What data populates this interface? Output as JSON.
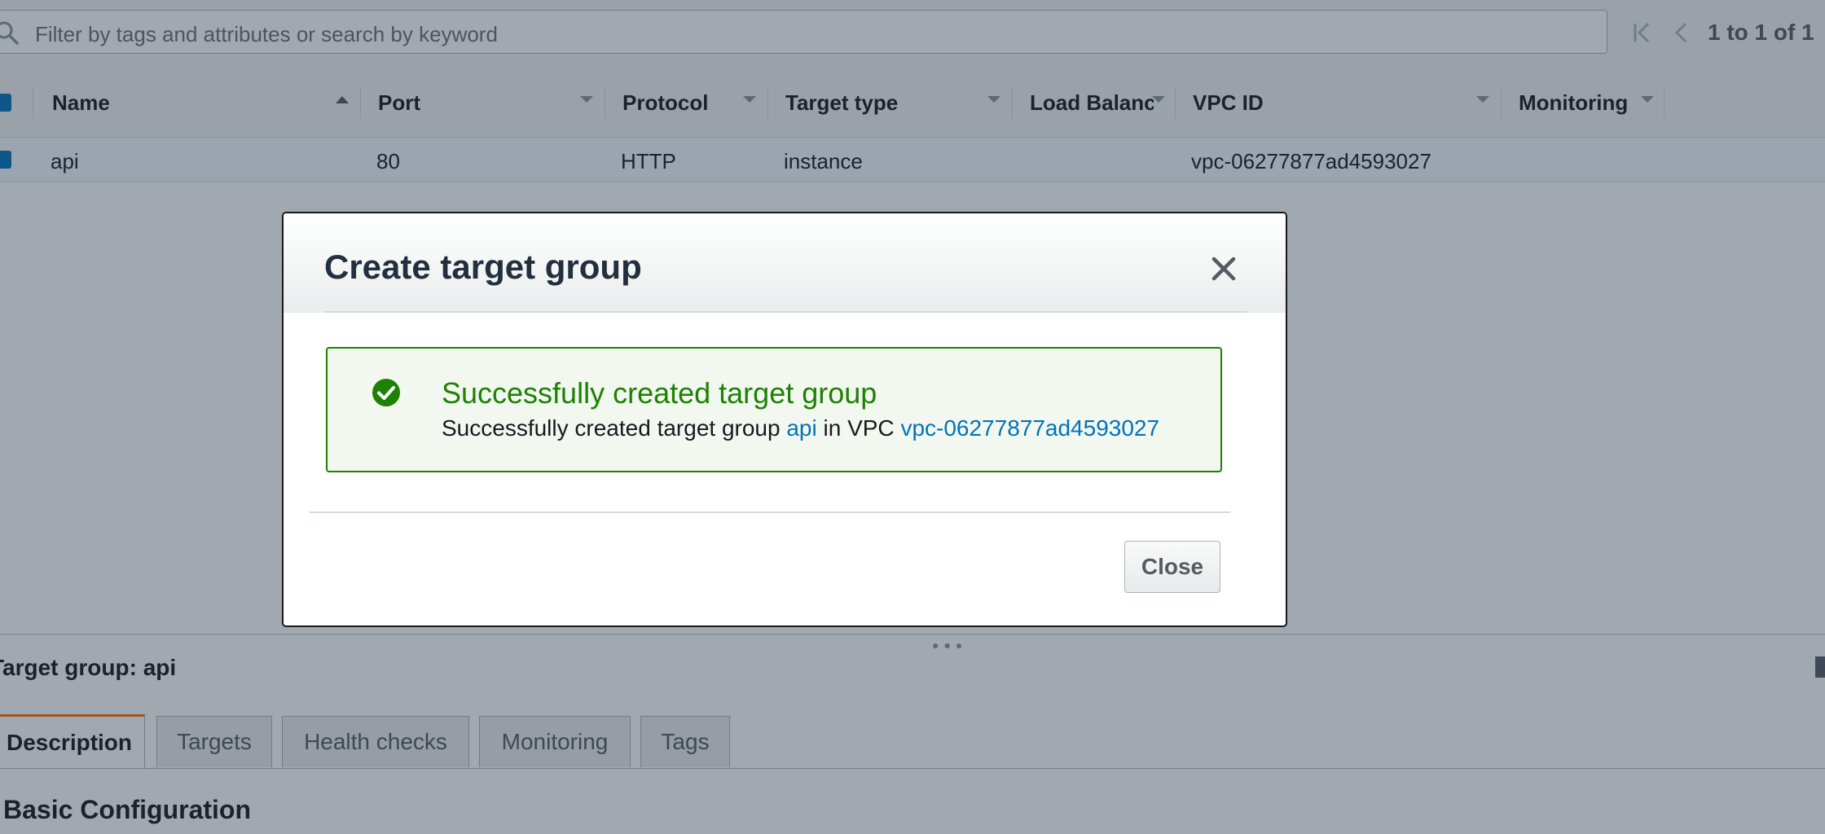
{
  "search": {
    "placeholder": "Filter by tags and attributes or search by keyword"
  },
  "pagination": {
    "text": "1 to 1 of 1"
  },
  "table": {
    "columns": [
      "Name",
      "Port",
      "Protocol",
      "Target type",
      "Load Balancer",
      "VPC ID",
      "Monitoring"
    ],
    "rows": [
      {
        "name": "api",
        "port": "80",
        "protocol": "HTTP",
        "target_type": "instance",
        "load_balancer": "",
        "vpc_id": "vpc-06277877ad4593027",
        "monitoring": ""
      }
    ]
  },
  "details": {
    "title": "Target group: api",
    "tabs": [
      "Description",
      "Targets",
      "Health checks",
      "Monitoring",
      "Tags"
    ],
    "active_tab": "Description",
    "section_title": "Basic Configuration"
  },
  "modal": {
    "title": "Create target group",
    "alert": {
      "title": "Successfully created target group",
      "prefix": "Successfully created target group",
      "group_link": "api",
      "middle": "in VPC",
      "vpc_link": "vpc-06277877ad4593027"
    },
    "close_button": "Close"
  },
  "colors": {
    "success": "#1d8102",
    "link": "#0073bb",
    "active_tab_accent": "#ec7211",
    "overlay": "rgba(34,48,66,0.42)"
  },
  "icons": {
    "search": "search-icon",
    "first_page": "first-page-icon",
    "prev_page": "previous-page-icon",
    "sort_asc": "sort-ascending-icon",
    "sort_menu": "column-dropdown-icon",
    "success": "check-circle-icon",
    "close": "close-icon"
  }
}
